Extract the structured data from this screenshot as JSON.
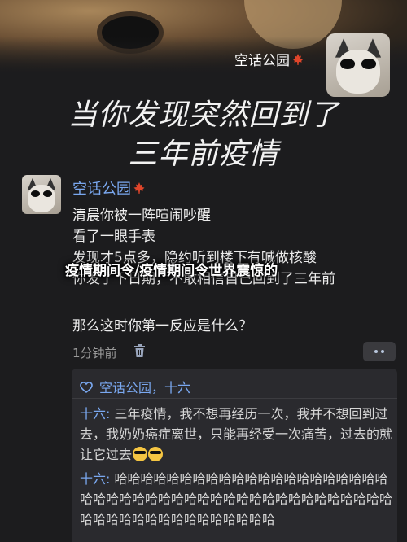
{
  "header": {
    "account_name": "空话公园"
  },
  "headline": {
    "line1": "当你发现突然回到了",
    "line2": "三年前疫情"
  },
  "overlay_title": "疫情期间令/疫情期间令世界震惊的",
  "post": {
    "author": "空话公园",
    "lines": [
      "清晨你被一阵喧闹吵醒",
      "看了一眼手表",
      "发现才5点多，隐约听到楼下有喊做核酸",
      "你发了下日期，不敢相信自己回到了三年前",
      "那么这时你第一反应是什么？"
    ],
    "time": "1分钟前"
  },
  "comments": {
    "likes": "空话公园，十六",
    "items": [
      {
        "author": "十六:",
        "text": " 三年疫情，我不想再经历一次，我并不想回到过去，我奶奶癌症离世，只能再经受一次痛苦，过去的就让它过去"
      },
      {
        "author": "十六:",
        "text": " 哈哈哈哈哈哈哈哈哈哈哈哈哈哈哈哈哈哈哈哈哈哈哈哈哈哈哈哈哈哈哈哈哈哈哈哈哈哈哈哈哈哈哈哈哈哈哈哈哈哈哈哈哈哈哈哈哈哈哈哈"
      }
    ]
  },
  "colors": {
    "background": "#1c1c1e",
    "link_blue": "#7aa8f0",
    "comment_panel": "#2a2a2e",
    "maple_red": "#e0452a"
  },
  "icons": [
    "maple-leaf-icon",
    "trash-icon",
    "more-icon",
    "heart-icon",
    "sunglasses-emoji-icon"
  ]
}
